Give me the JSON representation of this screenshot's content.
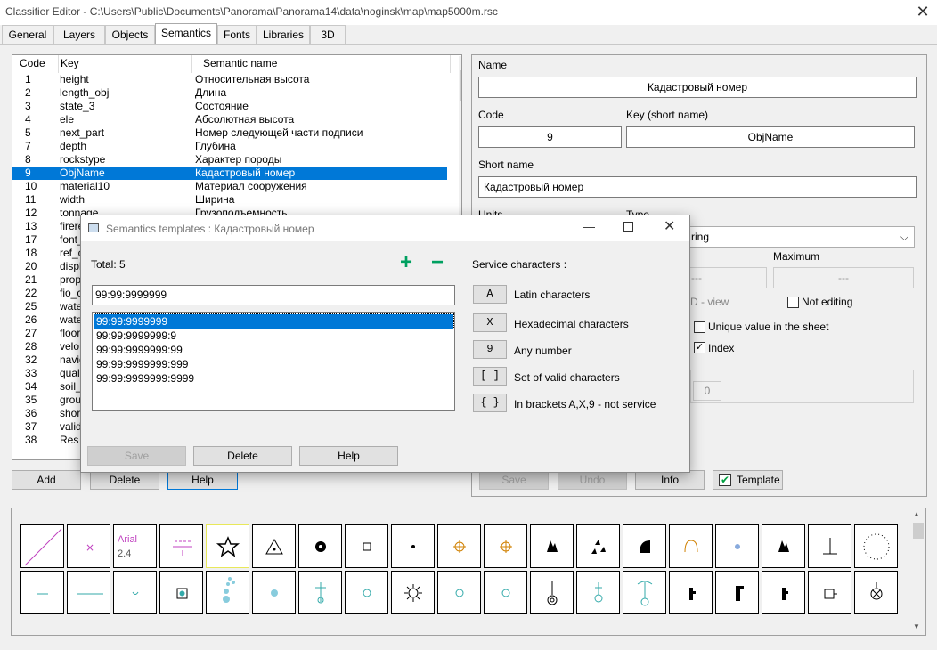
{
  "window": {
    "title": "Classifier Editor - C:\\Users\\Public\\Documents\\Panorama\\Panorama14\\data\\noginsk\\map\\map5000m.rsc",
    "close_glyph": "✕"
  },
  "tabs": [
    "General",
    "Layers",
    "Objects",
    "Semantics",
    "Fonts",
    "Libraries",
    "3D"
  ],
  "list": {
    "headers": {
      "code": "Code",
      "key": "Key",
      "name": "Semantic name"
    },
    "rows": [
      {
        "code": "1",
        "key": "height",
        "name": "Относительная высота"
      },
      {
        "code": "2",
        "key": "length_obj",
        "name": "Длина"
      },
      {
        "code": "3",
        "key": "state_3",
        "name": "Состояние"
      },
      {
        "code": "4",
        "key": "ele",
        "name": "Абсолютная высота"
      },
      {
        "code": "5",
        "key": "next_part",
        "name": "Номер следующей части подписи"
      },
      {
        "code": "7",
        "key": "depth",
        "name": "Глубина"
      },
      {
        "code": "8",
        "key": "rockstype",
        "name": "Характер породы"
      },
      {
        "code": "9",
        "key": "ObjName",
        "name": "Кадастровый номер"
      },
      {
        "code": "10",
        "key": "material10",
        "name": "Материал сооружения"
      },
      {
        "code": "11",
        "key": "width",
        "name": "Ширина"
      },
      {
        "code": "12",
        "key": "tonnage",
        "name": "Грузоподъемность"
      },
      {
        "code": "13",
        "key": "firere",
        "name": ""
      },
      {
        "code": "17",
        "key": "font_",
        "name": ""
      },
      {
        "code": "18",
        "key": "ref_c",
        "name": ""
      },
      {
        "code": "20",
        "key": "displ",
        "name": ""
      },
      {
        "code": "21",
        "key": "prop",
        "name": ""
      },
      {
        "code": "22",
        "key": "fio_c",
        "name": ""
      },
      {
        "code": "25",
        "key": "wate",
        "name": ""
      },
      {
        "code": "26",
        "key": "wate",
        "name": ""
      },
      {
        "code": "27",
        "key": "floor",
        "name": ""
      },
      {
        "code": "28",
        "key": "velo",
        "name": ""
      },
      {
        "code": "32",
        "key": "navig",
        "name": ""
      },
      {
        "code": "33",
        "key": "qual",
        "name": ""
      },
      {
        "code": "34",
        "key": "soil_",
        "name": ""
      },
      {
        "code": "35",
        "key": "grou",
        "name": ""
      },
      {
        "code": "36",
        "key": "shor",
        "name": ""
      },
      {
        "code": "37",
        "key": "valid",
        "name": ""
      },
      {
        "code": "38",
        "key": "Res",
        "name": ""
      }
    ],
    "buttons": {
      "add": "Add",
      "delete": "Delete",
      "help": "Help"
    }
  },
  "props": {
    "name_label": "Name",
    "name_value": "Кадастровый номер",
    "code_label": "Code",
    "code_value": "9",
    "key_label": "Key (short name)",
    "key_value": "ObjName",
    "short_label": "Short name",
    "short_value": "Кадастровый номер",
    "units_label": "Units",
    "type_label": "Type",
    "type_value": "ring",
    "maximum_label": "Maximum",
    "min_value": "---",
    "max_value": "---",
    "view_text": "D - view",
    "not_editing": "Not editing",
    "unique_value": "Unique value in the sheet",
    "index": "Index",
    "zero": "0",
    "buttons": {
      "save": "Save",
      "undo": "Undo",
      "info": "Info",
      "template": "Template"
    }
  },
  "dialog": {
    "title": "Semantics templates : Кадастровый номер",
    "total": "Total: 5",
    "input_value": "99:99:9999999",
    "templates": [
      "99:99:9999999",
      "99:99:9999999:9",
      "99:99:9999999:99",
      "99:99:9999999:999",
      "99:99:9999999:9999"
    ],
    "service_title": "Service characters :",
    "service": [
      {
        "key": "A",
        "label": "Latin characters"
      },
      {
        "key": "X",
        "label": "Hexadecimal characters"
      },
      {
        "key": "9",
        "label": "Any number"
      },
      {
        "key": "[ ]",
        "label": "Set of valid characters"
      },
      {
        "key": "{ }",
        "label": "In brackets A,X,9 - not service"
      }
    ],
    "buttons": {
      "save": "Save",
      "delete": "Delete",
      "help": "Help"
    },
    "plus": "+",
    "minus": "−"
  },
  "symbols": {
    "arial_label": "Arial",
    "arial_size": "2.4"
  },
  "colors": {
    "accent": "#0078d7",
    "green": "#00a040"
  }
}
